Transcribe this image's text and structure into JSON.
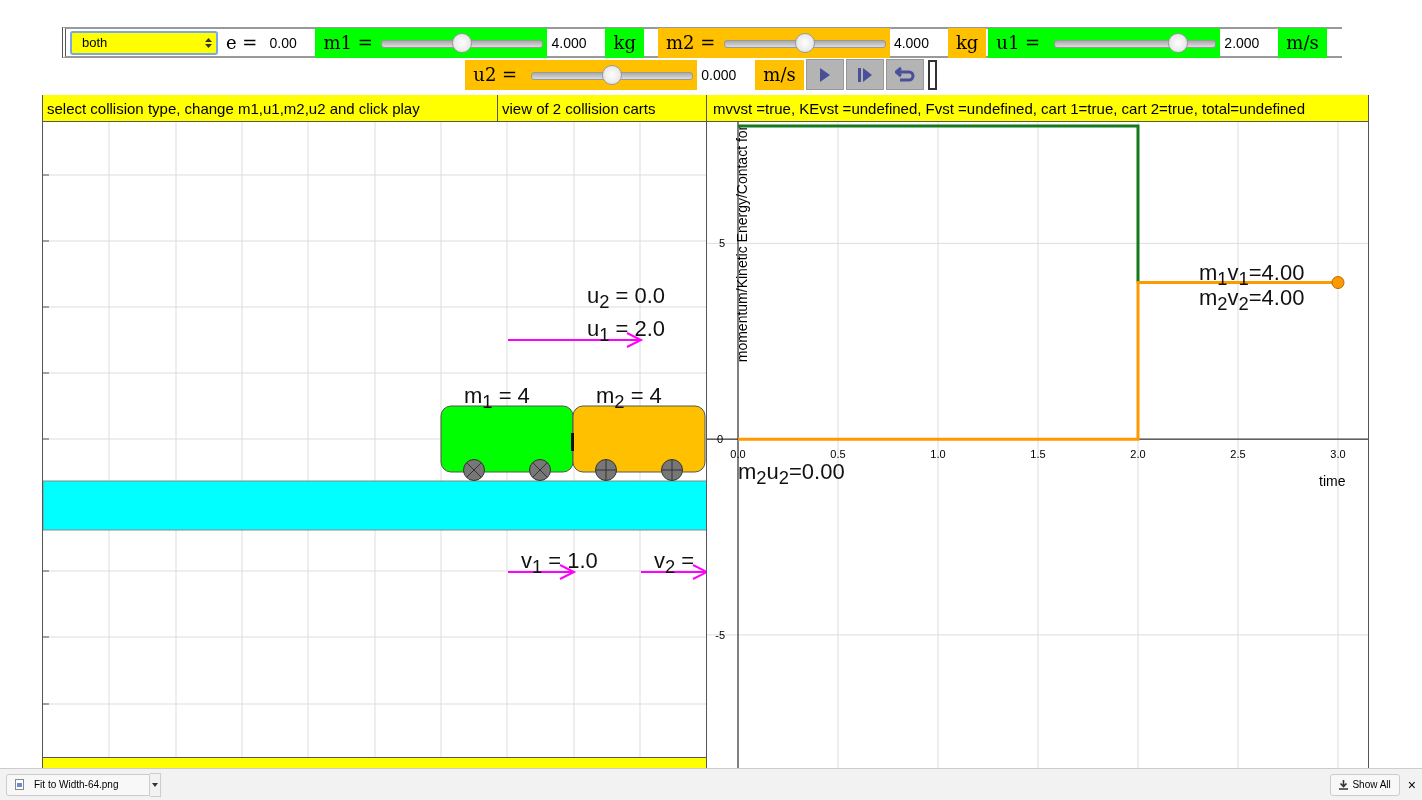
{
  "controls": {
    "collision_type": "both",
    "e": {
      "label": "e =",
      "value": "0.00"
    },
    "sliders": [
      {
        "label": "m1 =",
        "color": "#00ff00",
        "level": 0.5,
        "value": "4.000",
        "unit": "kg"
      },
      {
        "label": "m2 =",
        "color": "#ffc000",
        "level": 0.5,
        "value": "4.000",
        "unit": "kg"
      },
      {
        "label": "u1 =",
        "color": "#00ff00",
        "level": 0.8,
        "value": "2.000",
        "unit": "m/s"
      },
      {
        "label": "u2 =",
        "color": "#ffc000",
        "level": 0.5,
        "value": "0.000",
        "unit": "m/s"
      }
    ],
    "buttons": [
      {
        "kind": "play"
      },
      {
        "kind": "step"
      },
      {
        "kind": "reset"
      }
    ]
  },
  "cart_view": {
    "instructions": "select collision type, change m1,u1,m2,u2 and click play",
    "title": "view of 2 collision carts",
    "labels": [
      {
        "kind": "u2",
        "text": "u$_{2}$ = 0.0"
      },
      {
        "kind": "u1",
        "text": "u$_{1}$ = 2.0"
      },
      {
        "kind": "m1",
        "text": "m$_{1}$ = 4"
      },
      {
        "kind": "m2",
        "text": "m$_{2}$ = 4"
      },
      {
        "kind": "v1",
        "text": "v$_{1}$ = 1.0"
      },
      {
        "kind": "v2",
        "text": "v$_{2}$ ="
      }
    ],
    "carts": [
      {
        "color": "#00ff00"
      },
      {
        "color": "#ffc000"
      }
    ]
  },
  "graph": {
    "status": "mvvst =true, KEvst =undefined, Fvst =undefined, cart 1=true, cart 2=true, total=undefined",
    "labels": [
      {
        "kind": "m1v1",
        "text": "m$_{1}$v$_{1}$=4.00"
      },
      {
        "kind": "m2v2",
        "text": "m$_{2}$v$_{2}$=4.00"
      },
      {
        "kind": "m2u2",
        "text": "m$_{2}$u$_{2}$=0.00"
      }
    ],
    "chart_data": {
      "type": "line",
      "xlabel": "time",
      "ylabel": "momentum/Kinetic Energy/Contact for",
      "x": [
        0,
        2,
        2,
        3
      ],
      "series": [
        {
          "color": "#157a1c",
          "values": [
            8,
            8,
            4,
            null
          ]
        },
        {
          "color": "#ff9900",
          "values": [
            0,
            0,
            4,
            4
          ]
        }
      ],
      "xlim": [
        0,
        3
      ],
      "ylim": [
        -8.4,
        8.1
      ],
      "grid": true,
      "xticks": [
        {
          "value": 0,
          "label": "0.0"
        },
        {
          "value": 0.5,
          "label": "0.5"
        },
        {
          "value": 1,
          "label": "1.0"
        },
        {
          "value": 1.5,
          "label": "1.5"
        },
        {
          "value": 2,
          "label": "2.0"
        },
        {
          "value": 2.5,
          "label": "2.5"
        },
        {
          "value": 3,
          "label": "3.0"
        }
      ],
      "yticks": [
        -5,
        0,
        5
      ]
    }
  },
  "downloads": {
    "file": "Fit to Width-64.png",
    "show_all": "Show All",
    "close": "×"
  }
}
